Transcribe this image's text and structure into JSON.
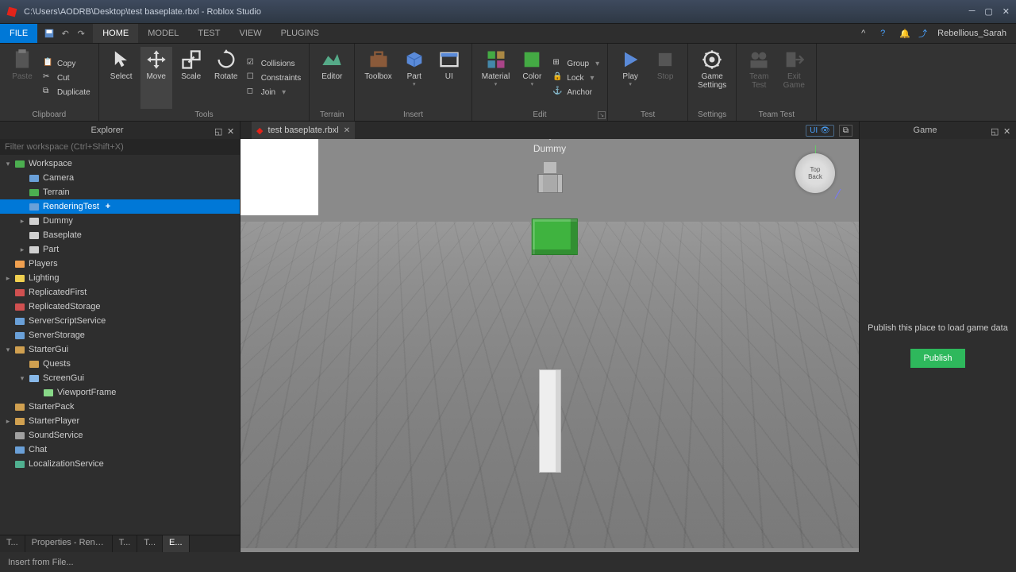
{
  "titlebar": {
    "title": "C:\\Users\\AODRB\\Desktop\\test baseplate.rbxl - Roblox Studio"
  },
  "menubar": {
    "file": "FILE",
    "tabs": [
      "HOME",
      "MODEL",
      "TEST",
      "VIEW",
      "PLUGINS"
    ],
    "active": 0,
    "username": "Rebellious_Sarah"
  },
  "ribbon": {
    "clipboard": {
      "label": "Clipboard",
      "paste": "Paste",
      "copy": "Copy",
      "cut": "Cut",
      "duplicate": "Duplicate"
    },
    "tools": {
      "label": "Tools",
      "select": "Select",
      "move": "Move",
      "scale": "Scale",
      "rotate": "Rotate",
      "collisions": "Collisions",
      "constraints": "Constraints",
      "join": "Join"
    },
    "terrain": {
      "label": "Terrain",
      "editor": "Editor"
    },
    "insert": {
      "label": "Insert",
      "toolbox": "Toolbox",
      "part": "Part",
      "ui": "UI"
    },
    "edit": {
      "label": "Edit",
      "material": "Material",
      "color": "Color",
      "group": "Group",
      "lock": "Lock",
      "anchor": "Anchor"
    },
    "test": {
      "label": "Test",
      "play": "Play",
      "stop": "Stop"
    },
    "settings": {
      "label": "Settings",
      "game_settings": "Game\nSettings"
    },
    "team": {
      "label": "Team Test",
      "team_test": "Team\nTest",
      "exit_game": "Exit\nGame"
    }
  },
  "explorer": {
    "title": "Explorer",
    "filter_placeholder": "Filter workspace (Ctrl+Shift+X)",
    "tree": [
      {
        "name": "Workspace",
        "indent": 0,
        "expand": "▾",
        "icon": "globe",
        "color": "#4caf50"
      },
      {
        "name": "Camera",
        "indent": 1,
        "expand": "",
        "icon": "camera",
        "color": "#6aa0d8"
      },
      {
        "name": "Terrain",
        "indent": 1,
        "expand": "",
        "icon": "terrain",
        "color": "#4caf50"
      },
      {
        "name": "RenderingTest",
        "indent": 1,
        "expand": "",
        "icon": "folder",
        "color": "#6aa0d8",
        "selected": true,
        "plus": true
      },
      {
        "name": "Dummy",
        "indent": 1,
        "expand": "▸",
        "icon": "model",
        "color": "#d0d0d0"
      },
      {
        "name": "Baseplate",
        "indent": 1,
        "expand": "",
        "icon": "part",
        "color": "#d0d0d0"
      },
      {
        "name": "Part",
        "indent": 1,
        "expand": "▸",
        "icon": "part",
        "color": "#d0d0d0"
      },
      {
        "name": "Players",
        "indent": 0,
        "expand": "",
        "icon": "players",
        "color": "#f0a050"
      },
      {
        "name": "Lighting",
        "indent": 0,
        "expand": "▸",
        "icon": "lighting",
        "color": "#f0d050"
      },
      {
        "name": "ReplicatedFirst",
        "indent": 0,
        "expand": "",
        "icon": "storage",
        "color": "#d05050"
      },
      {
        "name": "ReplicatedStorage",
        "indent": 0,
        "expand": "",
        "icon": "storage",
        "color": "#d05050"
      },
      {
        "name": "ServerScriptService",
        "indent": 0,
        "expand": "",
        "icon": "script",
        "color": "#6aa0d8"
      },
      {
        "name": "ServerStorage",
        "indent": 0,
        "expand": "",
        "icon": "storage",
        "color": "#6aa0d8"
      },
      {
        "name": "StarterGui",
        "indent": 0,
        "expand": "▾",
        "icon": "gui",
        "color": "#d0a050"
      },
      {
        "name": "Quests",
        "indent": 1,
        "expand": "",
        "icon": "folder",
        "color": "#d0a050"
      },
      {
        "name": "ScreenGui",
        "indent": 1,
        "expand": "▾",
        "icon": "screengui",
        "color": "#88b8e8"
      },
      {
        "name": "ViewportFrame",
        "indent": 2,
        "expand": "",
        "icon": "frame",
        "color": "#88d888"
      },
      {
        "name": "StarterPack",
        "indent": 0,
        "expand": "",
        "icon": "pack",
        "color": "#d0a050"
      },
      {
        "name": "StarterPlayer",
        "indent": 0,
        "expand": "▸",
        "icon": "player",
        "color": "#d0a050"
      },
      {
        "name": "SoundService",
        "indent": 0,
        "expand": "",
        "icon": "sound",
        "color": "#a0a0a0"
      },
      {
        "name": "Chat",
        "indent": 0,
        "expand": "",
        "icon": "chat",
        "color": "#6aa0d8"
      },
      {
        "name": "LocalizationService",
        "indent": 0,
        "expand": "",
        "icon": "local",
        "color": "#50b090"
      }
    ],
    "bottom_tabs": [
      "T...",
      "Properties - Renderi...",
      "T...",
      "T...",
      "E..."
    ],
    "bottom_active": 4
  },
  "viewport": {
    "file_tab": "test baseplate.rbxl",
    "ui_toggle": "UI",
    "dummy_label": "Dummy",
    "orientation": {
      "top": "Top",
      "back": "Back"
    }
  },
  "game": {
    "title": "Game",
    "message": "Publish this place to load game data",
    "publish": "Publish"
  },
  "statusbar": {
    "text": "Insert from File..."
  }
}
